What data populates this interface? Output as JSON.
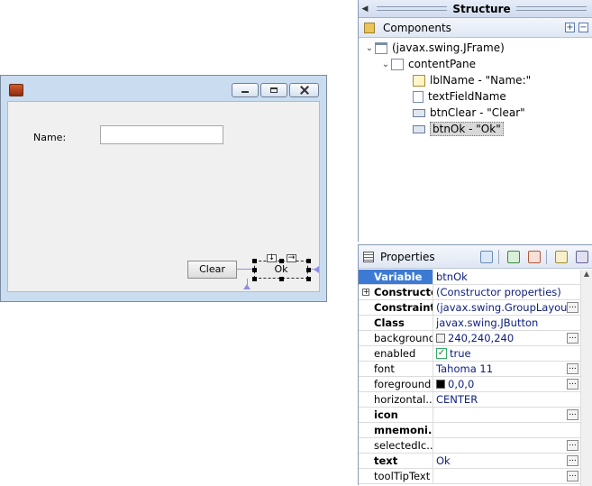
{
  "frame": {
    "label_name": "Name:",
    "textfield_value": "",
    "clear_label": "Clear",
    "ok_label": "Ok"
  },
  "structure": {
    "title": "Structure",
    "components_label": "Components",
    "tree": [
      {
        "text": "(javax.swing.JFrame)",
        "icon": "jframe-icon"
      },
      {
        "text": "contentPane",
        "icon": "panel-icon"
      },
      {
        "text": "lblName - \"Name:\"",
        "icon": "label-icon"
      },
      {
        "text": "textFieldName",
        "icon": "textfield-icon"
      },
      {
        "text": "btnClear - \"Clear\"",
        "icon": "button-icon"
      },
      {
        "text": "btnOk - \"Ok\"",
        "icon": "button-icon",
        "selected": true
      }
    ]
  },
  "properties": {
    "title": "Properties",
    "rows": [
      {
        "name": "Variable",
        "value": "btnOk",
        "bold": true,
        "selected": true
      },
      {
        "name": "Constructor",
        "value": "(Constructor properties)",
        "bold": true,
        "expander": true
      },
      {
        "name": "Constraints",
        "value": "(javax.swing.GroupLayout)",
        "bold": true,
        "dots": true
      },
      {
        "name": "Class",
        "value": "javax.swing.JButton",
        "bold": true
      },
      {
        "name": "background",
        "value": "240,240,240",
        "swatch": "#f0f0f0",
        "dots": true
      },
      {
        "name": "enabled",
        "value": "true",
        "check": true
      },
      {
        "name": "font",
        "value": "Tahoma 11",
        "dots": true
      },
      {
        "name": "foreground",
        "value": "0,0,0",
        "swatch": "#000000",
        "dots": true
      },
      {
        "name": "horizontal...",
        "value": "CENTER"
      },
      {
        "name": "icon",
        "value": "",
        "bold": true,
        "dots": true
      },
      {
        "name": "mnemoni...",
        "value": "",
        "bold": true
      },
      {
        "name": "selectedIc...",
        "value": "",
        "dots": true
      },
      {
        "name": "text",
        "value": "Ok",
        "bold": true,
        "dots": true
      },
      {
        "name": "toolTipText",
        "value": "",
        "dots": true
      }
    ]
  }
}
